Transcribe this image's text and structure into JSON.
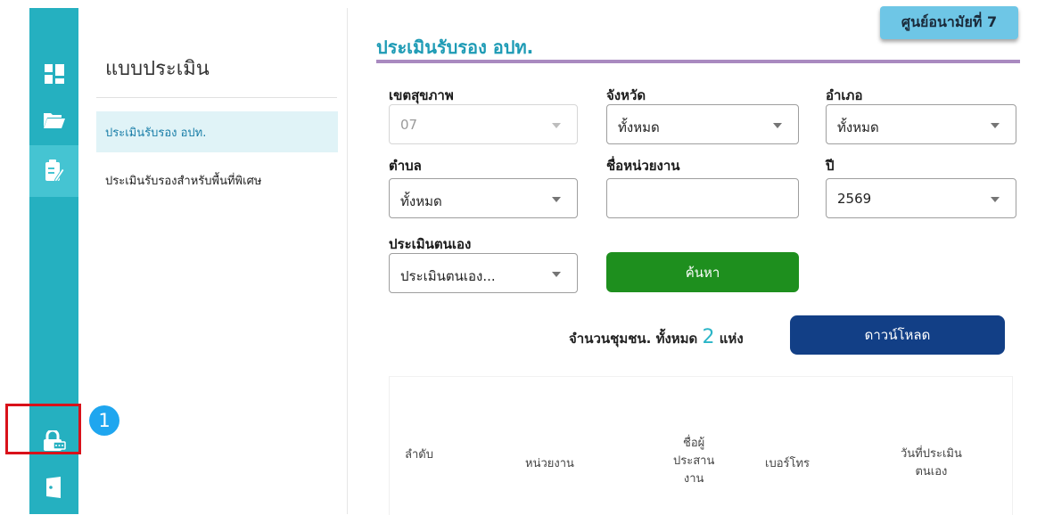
{
  "sidebar": {
    "icons": [
      "dashboard-icon",
      "folder-icon",
      "clipboard-edit-icon",
      "lock-keypad-icon",
      "logout-door-icon"
    ],
    "color": "#25b0c0"
  },
  "menu": {
    "title": "แบบประเมิน",
    "items": [
      {
        "label": "ประเมินรับรอง อปท.",
        "active": true
      },
      {
        "label": "ประเมินรับรองสำหรับพื้นที่พิเศษ",
        "active": false
      }
    ]
  },
  "header": {
    "badge": "ศูนย์อนามัยที่ 7",
    "title": "ประเมินรับรอง อปท."
  },
  "filters": {
    "health_zone": {
      "label": "เขตสุขภาพ",
      "value": "07",
      "disabled": true
    },
    "province": {
      "label": "จังหวัด",
      "value": "ทั้งหมด"
    },
    "district": {
      "label": "อำเภอ",
      "value": "ทั้งหมด"
    },
    "subdistrict": {
      "label": "ตำบล",
      "value": "ทั้งหมด"
    },
    "agency_name": {
      "label": "ชื่อหน่วยงาน",
      "value": ""
    },
    "year": {
      "label": "ปี",
      "value": "2569"
    },
    "self_assessment": {
      "label": "ประเมินตนเอง",
      "value": "ประเมินตนเอง..."
    }
  },
  "search_button": "ค้นหา",
  "count": {
    "prefix": "จำนวนชุมชน. ทั้งหมด",
    "value": "2",
    "suffix": "แห่ง"
  },
  "download_button": "ดาวน์โหลด",
  "table": {
    "headers": {
      "index": "ลำดับ",
      "agency": "หน่วยงาน",
      "coordinator": [
        "ชื่อผู้",
        "ประสาน",
        "งาน"
      ],
      "phone": "เบอร์โทร",
      "assess_date": [
        "วันที่ประเมิน",
        "ตนเอง"
      ]
    }
  },
  "annotation": {
    "number": "1",
    "color": "#d9111a"
  }
}
